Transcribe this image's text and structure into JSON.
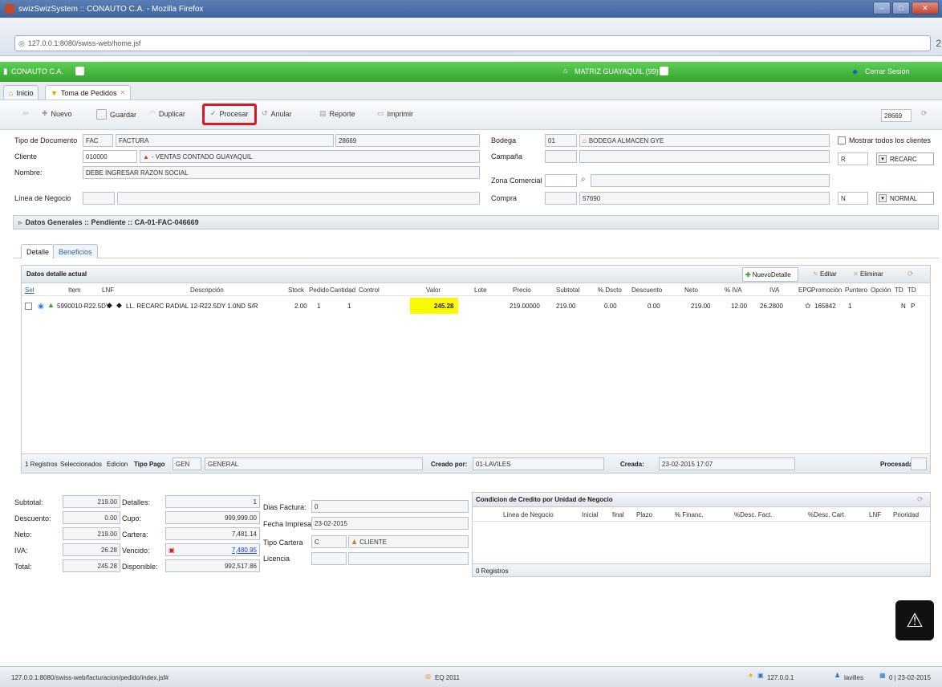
{
  "window": {
    "title": "swizSwizSystem :: CONAUTO C.A. - Mozilla Firefox"
  },
  "browser": {
    "url": "127.0.0.1:8080/swiss-web/home.jsf",
    "page_counter": "2"
  },
  "app": {
    "company": "CONAUTO C.A.",
    "branch": "MATRIZ GUAYAQUIL (99)",
    "logout": "Cerrar Sesión"
  },
  "tabs": [
    {
      "label": "Inicio"
    },
    {
      "label": "Toma de Pedidos"
    }
  ],
  "toolbar": {
    "nuevo": "Nuevo",
    "guardar": "Guardar",
    "duplicar": "Duplicar",
    "procesar": "Procesar",
    "anular": "Anular",
    "reporte": "Reporte",
    "imprimir": "Imprimir",
    "record_number": "28669"
  },
  "form": {
    "tipo_documento_label": "Tipo de Documento",
    "tipo_documento_code": "FAC",
    "tipo_documento_name": "FACTURA",
    "tipo_documento_num": "28669",
    "cliente_label": "Cliente",
    "cliente_code": "010000",
    "cliente_name": "- VENTAS CONTADO GUAYAQUIL",
    "nombre_label": "Nombre:",
    "nombre_value": "DEBE INGRESAR RAZON SOCIAL",
    "linea_label": "Línea de Negocio",
    "bodega_label": "Bodega",
    "bodega_code": "01",
    "bodega_name": "BODEGA ALMACEN GYE",
    "campana_label": "Campaña",
    "zona_label": "Zona Comercial",
    "compra_label": "Compra",
    "compra_value": "57690",
    "mostrar_label": "Mostrar todos los clientes",
    "sel1_code": "R",
    "sel1_value": "RECARC",
    "sel2_code": "N",
    "sel2_value": "NORMAL"
  },
  "datos_generales": "Datos Generales :: Pendiente :: CA-01-FAC-046669",
  "subtabs": [
    {
      "label": "Detalle"
    },
    {
      "label": "Beneficios"
    }
  ],
  "detalle": {
    "title": "Datos detalle actual",
    "nuevo": "NuevoDetalle",
    "editar": "Editar",
    "eliminar": "Eliminar",
    "columns": [
      "Sel",
      "Item",
      "LNF",
      "Descripción",
      "Stock",
      "Pedido",
      "Cantidad",
      "Control",
      "Valor",
      "Lote",
      "Precio",
      "Subtotal",
      "% Dscto",
      "Descuento",
      "Neto",
      "% IVA",
      "IVA",
      "EPG",
      "Promoción",
      "Puntero",
      "Opción",
      "TD",
      "TD"
    ],
    "row": {
      "item": "5990010-R22.5DY",
      "descripcion": "LL. RECARC RADIAL 12-R22.5DY 1.0ND S/R",
      "stock": "2.00",
      "pedido": "1",
      "cantidad": "1",
      "valor": "245.28",
      "precio": "219.00000",
      "subtotal": "219.00",
      "dscto": "0.00",
      "descuento": "0.00",
      "neto": "219.00",
      "piva": "12.00",
      "iva": "26.2800",
      "promocion": "165842",
      "puntero": "1",
      "td1": "N",
      "td2": "P"
    },
    "footer": {
      "registros": "1 Registros",
      "seleccionados": "Seleccionados",
      "edicion": "Edicion",
      "tipo_pago_label": "Tipo Pago",
      "tipo_pago_code": "GEN",
      "tipo_pago_name": "GENERAL",
      "creado_por_label": "Creado por:",
      "creado_por_value": "01-LAVILES",
      "creada_label": "Creada:",
      "creada_value": "23-02-2015 17:07",
      "procesada_label": "Procesada:"
    }
  },
  "totals": {
    "subtotal_label": "Subtotal:",
    "subtotal": "219.00",
    "descuento_label": "Descuento:",
    "descuento": "0.00",
    "neto_label": "Neto:",
    "neto": "219.00",
    "iva_label": "IVA:",
    "iva": "26.28",
    "total_label": "Total:",
    "total": "245.28",
    "detalles_label": "Detalles:",
    "detalles": "1",
    "cupo_label": "Cupo:",
    "cupo": "999,999.00",
    "cartera_label": "Cartera:",
    "cartera": "7,481.14",
    "vencido_label": "Vencido:",
    "vencido": "7,480.95",
    "disponible_label": "Disponible:",
    "disponible": "992,517.86",
    "dias_label": "Dias Factura:",
    "dias": "0",
    "fecha_label": "Fecha Impresa:",
    "fecha": "23-02-2015",
    "tipo_cartera_label": "Tipo Cartera",
    "tipo_cartera_code": "C",
    "tipo_cartera_name": "CLIENTE",
    "licencia_label": "Licencia"
  },
  "credito": {
    "title": "Condicion de Credito por Unidad de Negocio",
    "columns": [
      "Línea de Negocio",
      "Inicial",
      "final",
      "Plazo",
      "% Financ.",
      "%Desc. Fact.",
      "%Desc. Cart.",
      "LNF",
      "Prioridad"
    ],
    "footer": "0 Registros"
  },
  "statusbar": {
    "url": "127.0.0.1:8080/swiss-web/facturacion/pedido/index.jsf#",
    "center": "EQ 2011",
    "ip": "127.0.0.1",
    "user": "lavilles",
    "date": "0 | 23-02-2015"
  }
}
